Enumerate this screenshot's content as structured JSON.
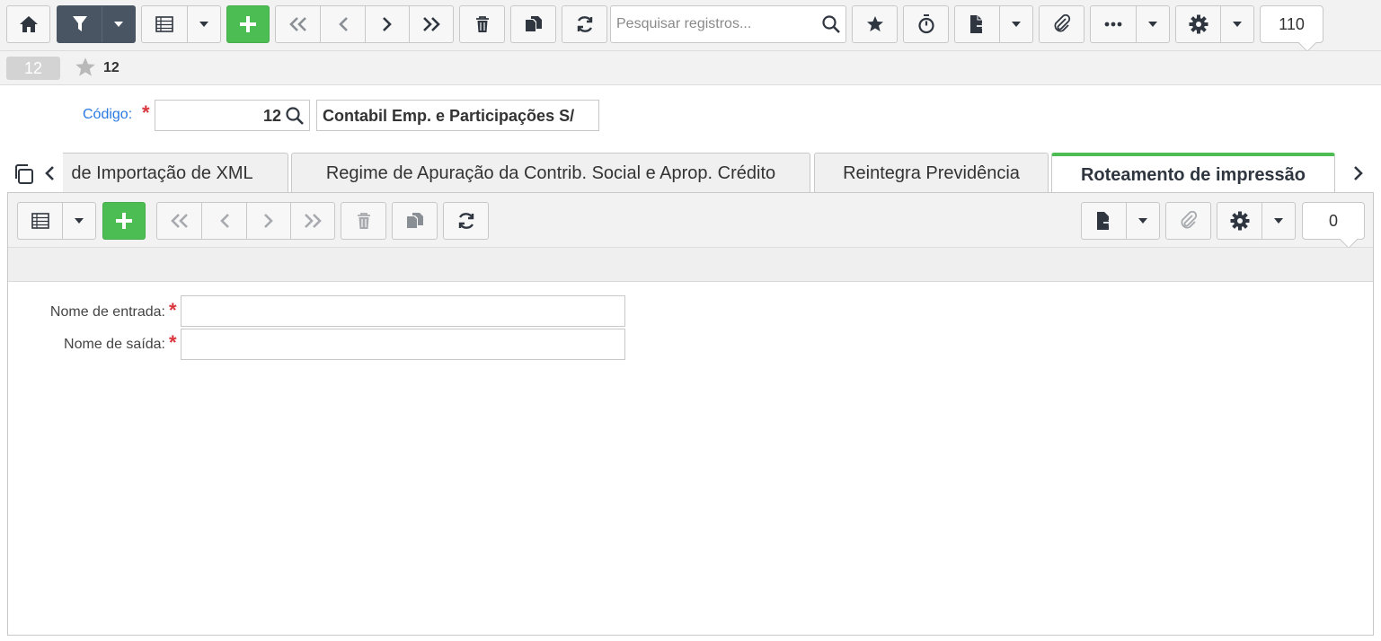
{
  "toolbar": {
    "search_placeholder": "Pesquisar registros...",
    "record_count": "110"
  },
  "record_bar": {
    "badge": "12",
    "title": "12"
  },
  "header": {
    "codigo_label": "Código:",
    "required_mark": "*",
    "codigo_value": "12",
    "company_name": "Contabil Emp. e Participações S/"
  },
  "tabs": [
    {
      "label": "de Importação de XML"
    },
    {
      "label": "Regime de Apuração da Contrib. Social e Aprop. Crédito"
    },
    {
      "label": "Reintegra Previdência"
    },
    {
      "label": "Roteamento de impressão",
      "active": true
    }
  ],
  "subtoolbar": {
    "record_count": "0"
  },
  "form": {
    "fields": [
      {
        "label": "Nome de entrada:",
        "value": ""
      },
      {
        "label": "Nome de saída:",
        "value": ""
      }
    ]
  },
  "colors": {
    "accent_green": "#4cbd52",
    "dark_button": "#4a5563",
    "link_blue": "#2a7ae2",
    "required_red": "#d9363e"
  }
}
